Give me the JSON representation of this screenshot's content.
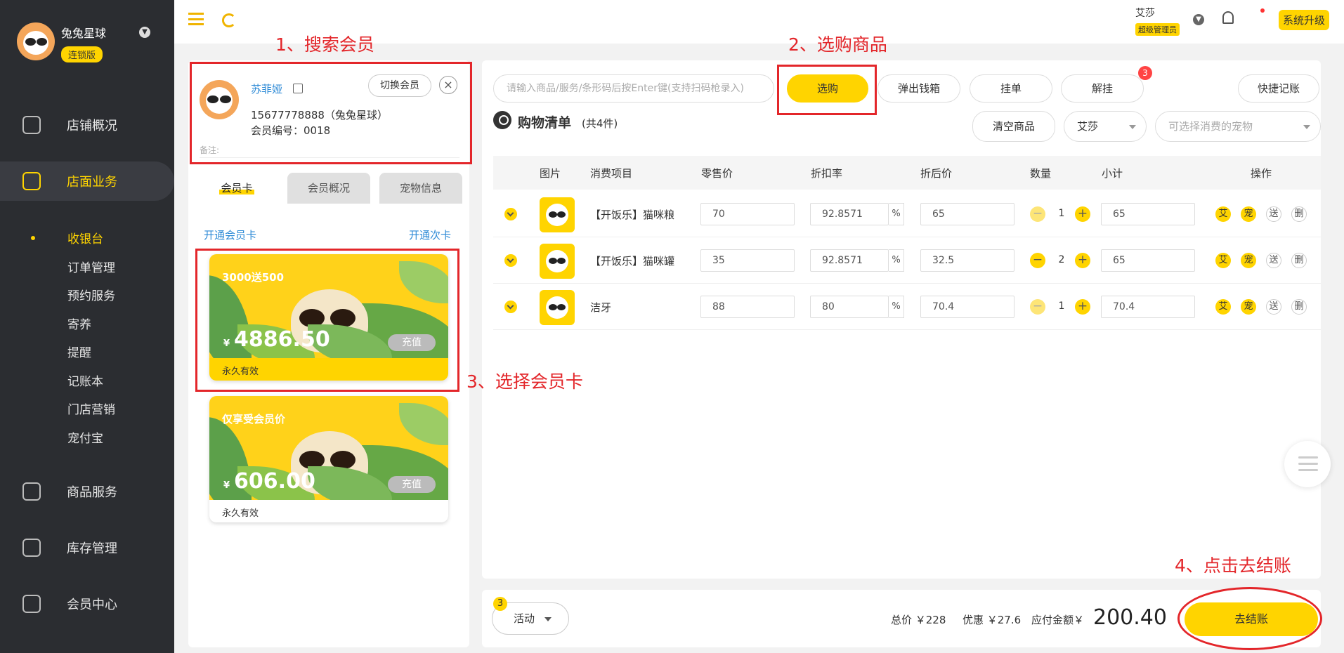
{
  "sidebar": {
    "store_name": "兔兔星球",
    "store_tag": "连锁版",
    "nav": [
      {
        "label": "店铺概况"
      },
      {
        "label": "店面业务"
      },
      {
        "label": "商品服务"
      },
      {
        "label": "库存管理"
      },
      {
        "label": "会员中心"
      }
    ],
    "sub_items": [
      {
        "label": "收银台"
      },
      {
        "label": "订单管理"
      },
      {
        "label": "预约服务"
      },
      {
        "label": "寄养"
      },
      {
        "label": "提醒"
      },
      {
        "label": "记账本"
      },
      {
        "label": "门店营销"
      },
      {
        "label": "宠付宝"
      }
    ]
  },
  "topbar": {
    "user_name": "艾莎",
    "user_role": "超级管理员",
    "upgrade_label": "系统升级"
  },
  "member": {
    "name": "苏菲娅",
    "phone_line": "15677778888（兔兔星球）",
    "number_line": "会员编号：0018",
    "remark_label": "备注:",
    "switch_label": "切换会员",
    "close_symbol": "×"
  },
  "tabs": [
    {
      "label": "会员卡"
    },
    {
      "label": "会员概况"
    },
    {
      "label": "宠物信息"
    }
  ],
  "links": {
    "open_member_card": "开通会员卡",
    "open_count_card": "开通次卡"
  },
  "cards": [
    {
      "title": "3000送500",
      "currency": "¥",
      "amount": "4886.50",
      "recharge": "充值",
      "validity": "永久有效"
    },
    {
      "title": "仅享受会员价",
      "currency": "¥",
      "amount": "606.00",
      "recharge": "充值",
      "validity": "永久有效"
    }
  ],
  "toolbar": {
    "search_placeholder": "请输入商品/服务/条形码后按Enter键(支持扫码枪录入)",
    "select_buy": "选购",
    "open_drawer": "弹出钱箱",
    "hang_order": "挂单",
    "unhang": "解挂",
    "unhang_badge": "3",
    "quick_account": "快捷记账",
    "clear_goods": "清空商品",
    "staff_select": "艾莎",
    "pet_select_placeholder": "可选择消费的宠物"
  },
  "cart": {
    "title": "购物清单",
    "count_text": "(共4件)",
    "headers": [
      "图片",
      "消费项目",
      "零售价",
      "折扣率",
      "折后价",
      "数量",
      "小计",
      "操作"
    ],
    "rows": [
      {
        "name": "【开饭乐】猫咪粮",
        "price": "70",
        "discount": "92.8571",
        "after": "65",
        "qty": "1",
        "subtotal": "65"
      },
      {
        "name": "【开饭乐】猫咪罐",
        "price": "35",
        "discount": "92.8571",
        "after": "32.5",
        "qty": "2",
        "subtotal": "65"
      },
      {
        "name": "洁牙",
        "price": "88",
        "discount": "80",
        "after": "70.4",
        "qty": "1",
        "subtotal": "70.4"
      }
    ],
    "pct_symbol": "%",
    "minus": "−",
    "plus": "+",
    "ops": [
      "艾",
      "宠",
      "送",
      "删"
    ]
  },
  "bottom": {
    "activity_badge": "3",
    "activity_label": "活动",
    "total_label": "总价 ￥228",
    "discount_label": "优惠 ￥27.6",
    "payable_label": "应付金额￥",
    "payable_amount": "200.40",
    "checkout_label": "去结账"
  },
  "annotations": {
    "step1": "1、搜索会员",
    "step2": "2、选购商品",
    "step3": "3、选择会员卡",
    "step4": "4、点击去结账",
    "color": "#e3262a"
  },
  "colors": {
    "accent": "#ffd400",
    "sidebar_bg": "#2b2d31",
    "link": "#2d8ad6"
  }
}
